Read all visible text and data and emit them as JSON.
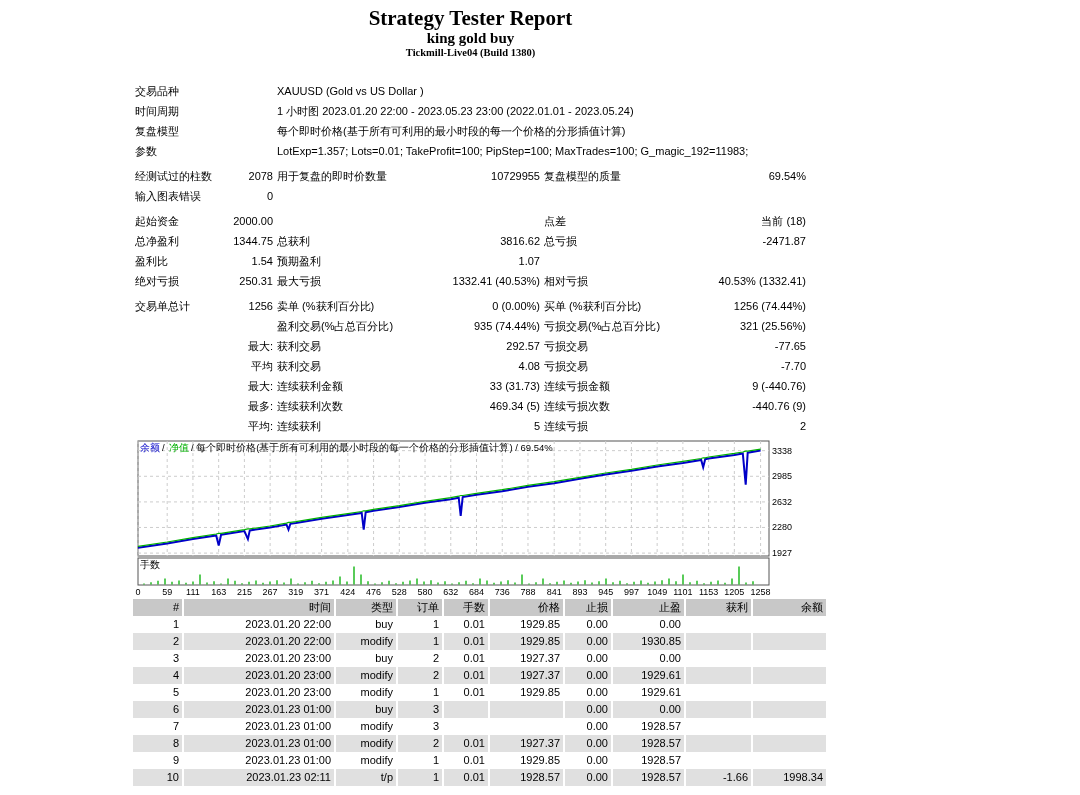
{
  "header": {
    "title": "Strategy Tester Report",
    "subtitle": "king gold buy",
    "server": "Tickmill-Live04 (Build 1380)"
  },
  "info": [
    {
      "label": "交易品种",
      "value": "XAUUSD (Gold vs US Dollar )"
    },
    {
      "label": "时间周期",
      "value": "1 小时图 2023.01.20 22:00 - 2023.05.23 23:00 (2022.01.01 - 2023.05.24)"
    },
    {
      "label": "复盘模型",
      "value": "每个即时价格(基于所有可利用的最小时段的每一个价格的分形插值计算)"
    },
    {
      "label": "参数",
      "value": "LotExp=1.357; Lots=0.01; TakeProfit=100; PipStep=100; MaxTrades=100; G_magic_192=11983;"
    }
  ],
  "stats_blocks": [
    [
      {
        "label_1": "经测试过的柱数",
        "value_1": "2078",
        "label_2": "用于复盘的即时价数量",
        "value_2": "10729955",
        "label_3": "复盘模型的质量",
        "value_3": "69.54%"
      },
      {
        "label_1": "输入图表错误",
        "value_1": "0"
      }
    ],
    [
      {
        "label_1": "起始资金",
        "value_1": "2000.00",
        "label_3": "点差",
        "value_3": "当前 (18)"
      },
      {
        "label_1": "总净盈利",
        "value_1": "1344.75",
        "label_2": "总获利",
        "value_2": "3816.62",
        "label_3": "总亏损",
        "value_3": "-2471.87"
      },
      {
        "label_1": "盈利比",
        "value_1": "1.54",
        "label_2": "预期盈利",
        "value_2": "1.07"
      },
      {
        "label_1": "绝对亏损",
        "value_1": "250.31",
        "label_2": "最大亏损",
        "value_2": "1332.41 (40.53%)",
        "label_3": "相对亏损",
        "value_3": "40.53% (1332.41)"
      }
    ],
    [
      {
        "label_1": "交易单总计",
        "value_1": "1256",
        "label_2": "卖单 (%获利百分比)",
        "value_2": "0 (0.00%)",
        "label_3": "买单 (%获利百分比)",
        "value_3": "1256 (74.44%)"
      },
      {
        "label_2": "盈利交易(%占总百分比)",
        "value_2": "935 (74.44%)",
        "label_3": "亏损交易(%占总百分比)",
        "value_3": "321 (25.56%)"
      },
      {
        "value_1": "最大:",
        "label_2": "获利交易",
        "value_2": "292.57",
        "label_3": "亏损交易",
        "value_3": "-77.65"
      },
      {
        "value_1": "平均",
        "label_2": "获利交易",
        "value_2": "4.08",
        "label_3": "亏损交易",
        "value_3": "-7.70"
      },
      {
        "value_1": "最大:",
        "label_2": "连续获利金额",
        "value_2": "33 (31.73)",
        "label_3": "连续亏损金额",
        "value_3": "9 (-440.76)"
      },
      {
        "value_1": "最多:",
        "label_2": "连续获利次数",
        "value_2": "469.34 (5)",
        "label_3": "连续亏损次数",
        "value_3": "-440.76 (9)"
      },
      {
        "value_1": "平均:",
        "label_2": "连续获利",
        "value_2": "5",
        "label_3": "连续亏损",
        "value_3": "2"
      }
    ]
  ],
  "chart": {
    "legend_separator": "/",
    "volume_label": "手数",
    "chart_data": {
      "type": "line",
      "title": "/ 每个即时价格(基于所有可利用的最小时段的每一个价格的分形插值计算) / 69.54%",
      "x": [
        0,
        59,
        111,
        158,
        163,
        168,
        215,
        222,
        226,
        267,
        300,
        304,
        308,
        319,
        371,
        424,
        452,
        456,
        460,
        476,
        528,
        580,
        632,
        648,
        652,
        656,
        684,
        736,
        788,
        841,
        893,
        945,
        997,
        1049,
        1101,
        1138,
        1142,
        1146,
        1153,
        1205,
        1222,
        1228,
        1232,
        1258
      ],
      "series": [
        {
          "name": "余额",
          "color": "#0000c8",
          "values": [
            2000,
            2060,
            2120,
            2170,
            2030,
            2180,
            2230,
            2120,
            2240,
            2280,
            2320,
            2250,
            2330,
            2340,
            2400,
            2450,
            2480,
            2250,
            2490,
            2510,
            2560,
            2620,
            2670,
            2690,
            2440,
            2700,
            2730,
            2780,
            2840,
            2890,
            2950,
            3010,
            3060,
            3120,
            3170,
            3210,
            3110,
            3220,
            3230,
            3280,
            3300,
            2870,
            3310,
            3340
          ]
        },
        {
          "name": "净值",
          "color": "#00b000",
          "values": [
            2020,
            2080,
            2140,
            2190,
            2200,
            2200,
            2250,
            2260,
            2260,
            2300,
            2340,
            2350,
            2350,
            2360,
            2420,
            2470,
            2500,
            2510,
            2510,
            2530,
            2580,
            2640,
            2690,
            2710,
            2720,
            2720,
            2750,
            2800,
            2860,
            2910,
            2970,
            3030,
            3080,
            3140,
            3190,
            3230,
            3240,
            3240,
            3250,
            3300,
            3320,
            3330,
            3330,
            3360
          ]
        }
      ],
      "grid": true,
      "xlim": [
        0,
        1275
      ],
      "ylim": [
        1887,
        3471
      ],
      "xticks": [
        0,
        59,
        111,
        163,
        215,
        267,
        319,
        371,
        424,
        476,
        528,
        580,
        632,
        684,
        736,
        788,
        841,
        893,
        945,
        997,
        1049,
        1101,
        1153,
        1205,
        1258
      ],
      "yticks": [
        3338,
        2985,
        2632,
        2280,
        1927
      ]
    }
  },
  "table": {
    "columns": [
      "#",
      "时间",
      "类型",
      "订单",
      "手数",
      "价格",
      "止损",
      "止盈",
      "获利",
      "余额"
    ],
    "rows": [
      [
        "1",
        "2023.01.20 22:00",
        "buy",
        "1",
        "0.01",
        "1929.85",
        "0.00",
        "0.00",
        null,
        null
      ],
      [
        "2",
        "2023.01.20 22:00",
        "modify",
        "1",
        "0.01",
        "1929.85",
        "0.00",
        "1930.85",
        null,
        null
      ],
      [
        "3",
        "2023.01.20 23:00",
        "buy",
        "2",
        "0.01",
        "1927.37",
        "0.00",
        "0.00",
        null,
        null
      ],
      [
        "4",
        "2023.01.20 23:00",
        "modify",
        "2",
        "0.01",
        "1927.37",
        "0.00",
        "1929.61",
        null,
        null
      ],
      [
        "5",
        "2023.01.20 23:00",
        "modify",
        "1",
        "0.01",
        "1929.85",
        "0.00",
        "1929.61",
        null,
        null
      ],
      [
        "6",
        "2023.01.23 01:00",
        "buy",
        "3",
        null,
        null,
        "0.00",
        "0.00",
        null,
        null
      ],
      [
        "7",
        "2023.01.23 01:00",
        "modify",
        "3",
        null,
        null,
        "0.00",
        "1928.57",
        null,
        null
      ],
      [
        "8",
        "2023.01.23 01:00",
        "modify",
        "2",
        "0.01",
        "1927.37",
        "0.00",
        "1928.57",
        null,
        null
      ],
      [
        "9",
        "2023.01.23 01:00",
        "modify",
        "1",
        "0.01",
        "1929.85",
        "0.00",
        "1928.57",
        null,
        null
      ],
      [
        "10",
        "2023.01.23 02:11",
        "t/p",
        "1",
        "0.01",
        "1928.57",
        "0.00",
        "1928.57",
        "-1.66",
        "1998.34"
      ]
    ]
  }
}
